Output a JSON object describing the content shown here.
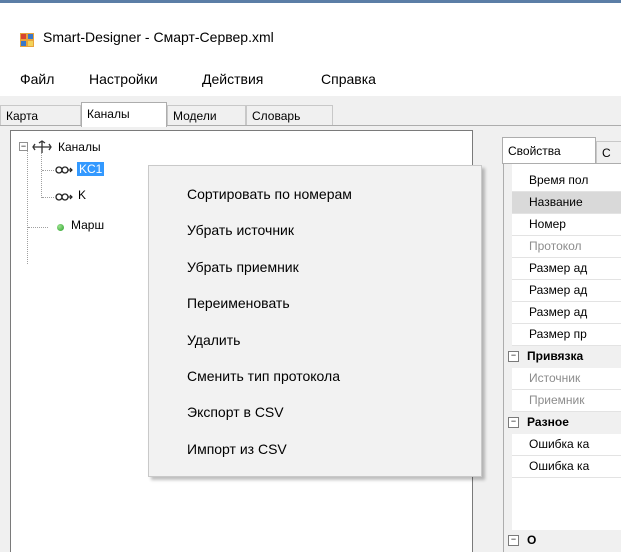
{
  "window": {
    "title": "Smart-Designer - Смарт-Сервер.xml"
  },
  "menu": [
    "Файл",
    "Настройки",
    "Действия",
    "Справка"
  ],
  "tabs": [
    "Карта",
    "Каналы",
    "Модели",
    "Словарь"
  ],
  "tree": {
    "root": "Каналы",
    "children": [
      "KC1",
      "K"
    ],
    "second_root": "Марш"
  },
  "context_menu": [
    "Сортировать по номерам",
    "Убрать источник",
    "Убрать приемник",
    "Переименовать",
    "Удалить",
    "Сменить тип протокола",
    "Экспорт в CSV",
    "Импорт из CSV"
  ],
  "properties": {
    "tabs": [
      "Свойства",
      "С"
    ],
    "rows": [
      {
        "label": "Время пол",
        "state": "normal"
      },
      {
        "label": "Название",
        "state": "selected"
      },
      {
        "label": "Номер",
        "state": "normal"
      },
      {
        "label": "Протокол",
        "state": "gray"
      },
      {
        "label": "Размер ад",
        "state": "normal"
      },
      {
        "label": "Размер ад",
        "state": "normal"
      },
      {
        "label": "Размер ад",
        "state": "normal"
      },
      {
        "label": "Размер пр",
        "state": "normal"
      }
    ],
    "category_binding": "Привязка",
    "binding_rows": [
      "Источник",
      "Приемник"
    ],
    "category_misc": "Разное",
    "misc_rows": [
      "Ошибка ка",
      "Ошибка ка"
    ],
    "category_last": "О"
  }
}
